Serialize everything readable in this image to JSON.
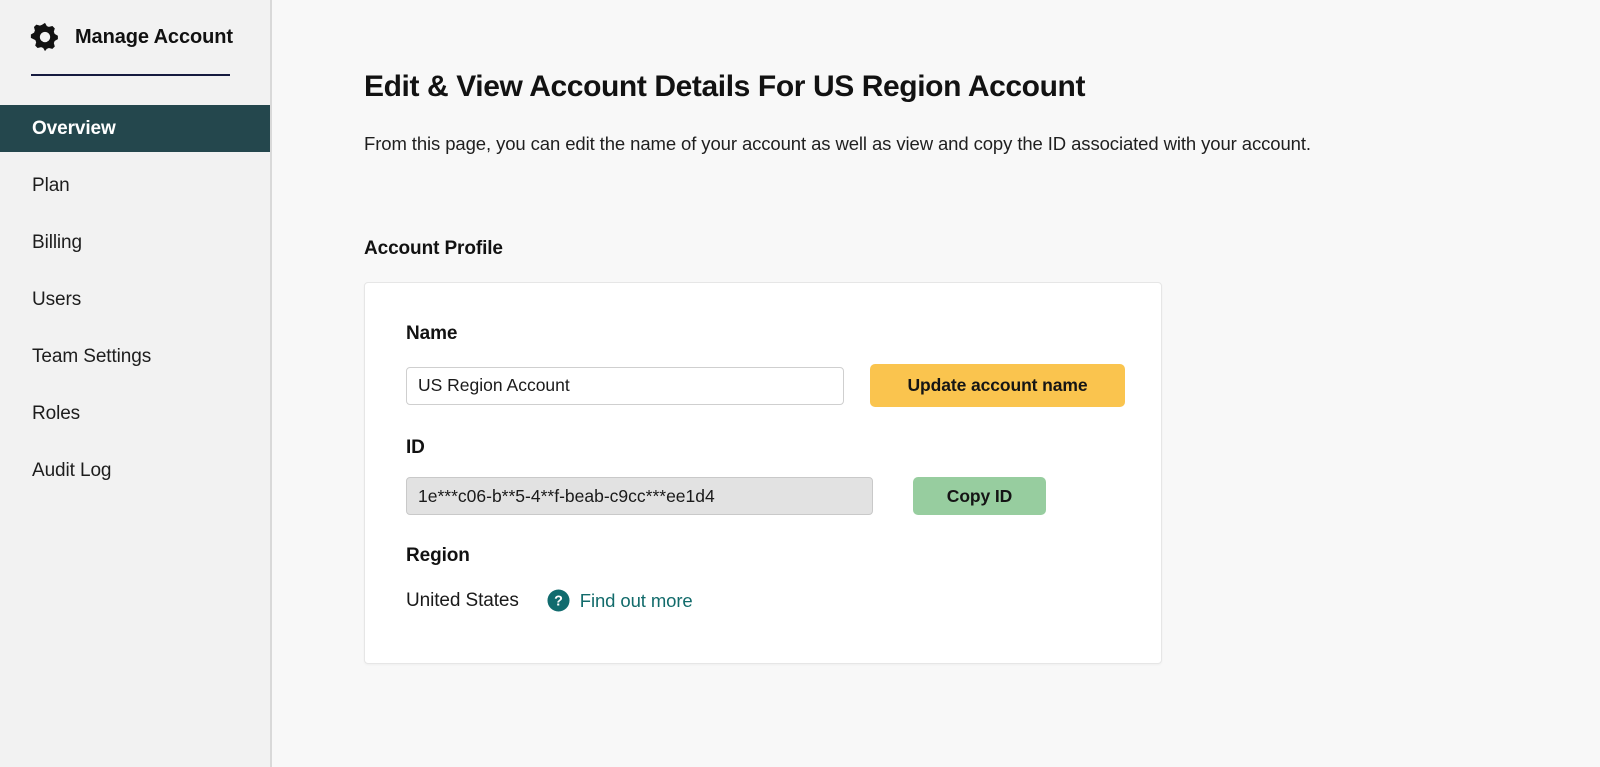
{
  "sidebar": {
    "brand": {
      "title": "Manage Account",
      "icon": "gear-icon"
    },
    "items": [
      {
        "label": "Overview",
        "active": true
      },
      {
        "label": "Plan",
        "active": false
      },
      {
        "label": "Billing",
        "active": false
      },
      {
        "label": "Users",
        "active": false
      },
      {
        "label": "Team Settings",
        "active": false
      },
      {
        "label": "Roles",
        "active": false
      },
      {
        "label": "Audit Log",
        "active": false
      }
    ]
  },
  "main": {
    "title": "Edit & View Account Details For US Region Account",
    "subtitle": "From this page, you can edit the name of your account as well as view and copy the ID associated with your account.",
    "section_label": "Account Profile",
    "name": {
      "label": "Name",
      "value": "US Region Account",
      "placeholder": "Account name",
      "button_label": "Update account name"
    },
    "id": {
      "label": "ID",
      "value": "1e***c06-b**5-4**f-beab-c9cc***ee1d4",
      "button_label": "Copy ID"
    },
    "region": {
      "label": "Region",
      "value": "United States",
      "help_icon": "question-mark-circle-icon",
      "link_label": "Find out more"
    }
  },
  "colors": {
    "active_nav": "#24474d",
    "update_button": "#fac44e",
    "copy_button": "#97cd9f",
    "link_teal": "#126b6b",
    "divider_navy": "#161b3f",
    "sidebar_bg": "#f2f2f2",
    "main_bg": "#f8f8f8"
  }
}
